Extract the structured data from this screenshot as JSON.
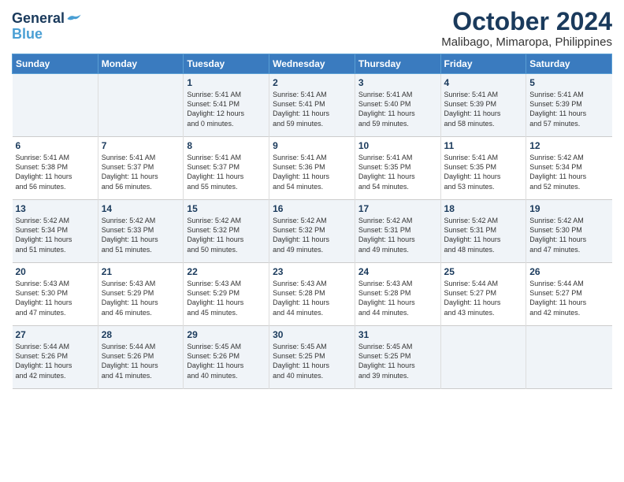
{
  "logo": {
    "line1": "General",
    "line2": "Blue"
  },
  "title": "October 2024",
  "location": "Malibago, Mimaropa, Philippines",
  "days_of_week": [
    "Sunday",
    "Monday",
    "Tuesday",
    "Wednesday",
    "Thursday",
    "Friday",
    "Saturday"
  ],
  "weeks": [
    [
      {
        "num": "",
        "text": ""
      },
      {
        "num": "",
        "text": ""
      },
      {
        "num": "1",
        "text": "Sunrise: 5:41 AM\nSunset: 5:41 PM\nDaylight: 12 hours\nand 0 minutes."
      },
      {
        "num": "2",
        "text": "Sunrise: 5:41 AM\nSunset: 5:41 PM\nDaylight: 11 hours\nand 59 minutes."
      },
      {
        "num": "3",
        "text": "Sunrise: 5:41 AM\nSunset: 5:40 PM\nDaylight: 11 hours\nand 59 minutes."
      },
      {
        "num": "4",
        "text": "Sunrise: 5:41 AM\nSunset: 5:39 PM\nDaylight: 11 hours\nand 58 minutes."
      },
      {
        "num": "5",
        "text": "Sunrise: 5:41 AM\nSunset: 5:39 PM\nDaylight: 11 hours\nand 57 minutes."
      }
    ],
    [
      {
        "num": "6",
        "text": "Sunrise: 5:41 AM\nSunset: 5:38 PM\nDaylight: 11 hours\nand 56 minutes."
      },
      {
        "num": "7",
        "text": "Sunrise: 5:41 AM\nSunset: 5:37 PM\nDaylight: 11 hours\nand 56 minutes."
      },
      {
        "num": "8",
        "text": "Sunrise: 5:41 AM\nSunset: 5:37 PM\nDaylight: 11 hours\nand 55 minutes."
      },
      {
        "num": "9",
        "text": "Sunrise: 5:41 AM\nSunset: 5:36 PM\nDaylight: 11 hours\nand 54 minutes."
      },
      {
        "num": "10",
        "text": "Sunrise: 5:41 AM\nSunset: 5:35 PM\nDaylight: 11 hours\nand 54 minutes."
      },
      {
        "num": "11",
        "text": "Sunrise: 5:41 AM\nSunset: 5:35 PM\nDaylight: 11 hours\nand 53 minutes."
      },
      {
        "num": "12",
        "text": "Sunrise: 5:42 AM\nSunset: 5:34 PM\nDaylight: 11 hours\nand 52 minutes."
      }
    ],
    [
      {
        "num": "13",
        "text": "Sunrise: 5:42 AM\nSunset: 5:34 PM\nDaylight: 11 hours\nand 51 minutes."
      },
      {
        "num": "14",
        "text": "Sunrise: 5:42 AM\nSunset: 5:33 PM\nDaylight: 11 hours\nand 51 minutes."
      },
      {
        "num": "15",
        "text": "Sunrise: 5:42 AM\nSunset: 5:32 PM\nDaylight: 11 hours\nand 50 minutes."
      },
      {
        "num": "16",
        "text": "Sunrise: 5:42 AM\nSunset: 5:32 PM\nDaylight: 11 hours\nand 49 minutes."
      },
      {
        "num": "17",
        "text": "Sunrise: 5:42 AM\nSunset: 5:31 PM\nDaylight: 11 hours\nand 49 minutes."
      },
      {
        "num": "18",
        "text": "Sunrise: 5:42 AM\nSunset: 5:31 PM\nDaylight: 11 hours\nand 48 minutes."
      },
      {
        "num": "19",
        "text": "Sunrise: 5:42 AM\nSunset: 5:30 PM\nDaylight: 11 hours\nand 47 minutes."
      }
    ],
    [
      {
        "num": "20",
        "text": "Sunrise: 5:43 AM\nSunset: 5:30 PM\nDaylight: 11 hours\nand 47 minutes."
      },
      {
        "num": "21",
        "text": "Sunrise: 5:43 AM\nSunset: 5:29 PM\nDaylight: 11 hours\nand 46 minutes."
      },
      {
        "num": "22",
        "text": "Sunrise: 5:43 AM\nSunset: 5:29 PM\nDaylight: 11 hours\nand 45 minutes."
      },
      {
        "num": "23",
        "text": "Sunrise: 5:43 AM\nSunset: 5:28 PM\nDaylight: 11 hours\nand 44 minutes."
      },
      {
        "num": "24",
        "text": "Sunrise: 5:43 AM\nSunset: 5:28 PM\nDaylight: 11 hours\nand 44 minutes."
      },
      {
        "num": "25",
        "text": "Sunrise: 5:44 AM\nSunset: 5:27 PM\nDaylight: 11 hours\nand 43 minutes."
      },
      {
        "num": "26",
        "text": "Sunrise: 5:44 AM\nSunset: 5:27 PM\nDaylight: 11 hours\nand 42 minutes."
      }
    ],
    [
      {
        "num": "27",
        "text": "Sunrise: 5:44 AM\nSunset: 5:26 PM\nDaylight: 11 hours\nand 42 minutes."
      },
      {
        "num": "28",
        "text": "Sunrise: 5:44 AM\nSunset: 5:26 PM\nDaylight: 11 hours\nand 41 minutes."
      },
      {
        "num": "29",
        "text": "Sunrise: 5:45 AM\nSunset: 5:26 PM\nDaylight: 11 hours\nand 40 minutes."
      },
      {
        "num": "30",
        "text": "Sunrise: 5:45 AM\nSunset: 5:25 PM\nDaylight: 11 hours\nand 40 minutes."
      },
      {
        "num": "31",
        "text": "Sunrise: 5:45 AM\nSunset: 5:25 PM\nDaylight: 11 hours\nand 39 minutes."
      },
      {
        "num": "",
        "text": ""
      },
      {
        "num": "",
        "text": ""
      }
    ]
  ]
}
